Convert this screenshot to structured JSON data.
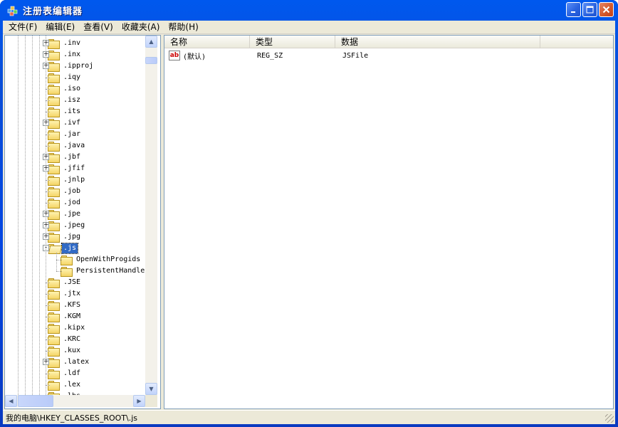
{
  "window": {
    "title": "注册表编辑器"
  },
  "menu": [
    "文件(F)",
    "编辑(E)",
    "查看(V)",
    "收藏夹(A)",
    "帮助(H)"
  ],
  "tree": {
    "items": [
      {
        "label": ".inv",
        "expander": "+"
      },
      {
        "label": ".inx",
        "expander": "+"
      },
      {
        "label": ".ipproj",
        "expander": "+"
      },
      {
        "label": ".iqy",
        "expander": ""
      },
      {
        "label": ".iso",
        "expander": ""
      },
      {
        "label": ".isz",
        "expander": ""
      },
      {
        "label": ".its",
        "expander": ""
      },
      {
        "label": ".ivf",
        "expander": "+"
      },
      {
        "label": ".jar",
        "expander": ""
      },
      {
        "label": ".java",
        "expander": ""
      },
      {
        "label": ".jbf",
        "expander": "+"
      },
      {
        "label": ".jfif",
        "expander": "+"
      },
      {
        "label": ".jnlp",
        "expander": ""
      },
      {
        "label": ".job",
        "expander": ""
      },
      {
        "label": ".jod",
        "expander": ""
      },
      {
        "label": ".jpe",
        "expander": "+"
      },
      {
        "label": ".jpeg",
        "expander": "+"
      },
      {
        "label": ".jpg",
        "expander": "+"
      },
      {
        "label": ".js",
        "expander": "-",
        "selected": true,
        "open": true
      },
      {
        "label": "OpenWithProgids",
        "expander": "",
        "child": true
      },
      {
        "label": "PersistentHandle",
        "expander": "",
        "child": true
      },
      {
        "label": ".JSE",
        "expander": ""
      },
      {
        "label": ".jtx",
        "expander": ""
      },
      {
        "label": ".KFS",
        "expander": ""
      },
      {
        "label": ".KGM",
        "expander": ""
      },
      {
        "label": ".kipx",
        "expander": ""
      },
      {
        "label": ".KRC",
        "expander": ""
      },
      {
        "label": ".kux",
        "expander": ""
      },
      {
        "label": ".latex",
        "expander": "+"
      },
      {
        "label": ".ldf",
        "expander": ""
      },
      {
        "label": ".lex",
        "expander": ""
      },
      {
        "label": ".lhs",
        "expander": ""
      }
    ]
  },
  "list": {
    "columns": [
      "名称",
      "类型",
      "数据"
    ],
    "rows": [
      {
        "icon": "ab",
        "name": "(默认)",
        "type": "REG_SZ",
        "data": "JSFile"
      }
    ]
  },
  "scroll": {
    "up": "▲",
    "down": "▼",
    "left": "◀",
    "right": "▶"
  },
  "status": {
    "path": "我的电脑\\HKEY_CLASSES_ROOT\\.js"
  },
  "colors": {
    "titlebar": "#0346e3",
    "selection": "#316ac5",
    "chrome": "#ece9d8"
  }
}
